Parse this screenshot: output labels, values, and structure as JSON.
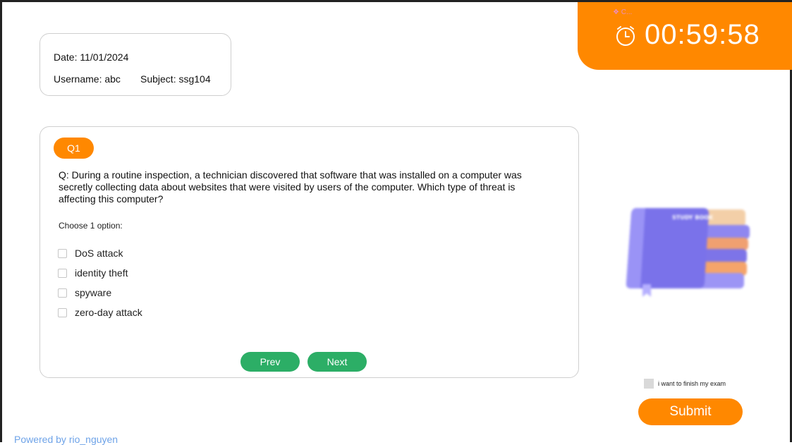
{
  "info": {
    "date": "Date: 11/01/2024",
    "username": "Username: abc",
    "subject": "Subject: ssg104"
  },
  "timer": {
    "tag": "❖ C...",
    "value": "00:59:58",
    "icon": "alarm-clock-icon"
  },
  "question": {
    "badge": "Q1",
    "text": "Q: During a routine inspection, a technician discovered that software that was installed on a computer was secretly collecting data about websites that were visited by users of the computer. Which type of threat is affecting this computer?",
    "choose_label": "Choose 1 option:",
    "options": [
      {
        "label": "DoS attack"
      },
      {
        "label": "identity theft"
      },
      {
        "label": "spyware"
      },
      {
        "label": "zero-day attack"
      }
    ],
    "prev": "Prev",
    "next": "Next"
  },
  "illustration": {
    "book_text": "STUDY BOOK"
  },
  "finish": {
    "label": "i want to finish my exam",
    "submit": "Submit"
  },
  "footer": "Powered by rio_nguyen",
  "colors": {
    "accent": "#ff8800",
    "nav_button": "#2cae66",
    "footer_link": "#6ea3e8"
  }
}
